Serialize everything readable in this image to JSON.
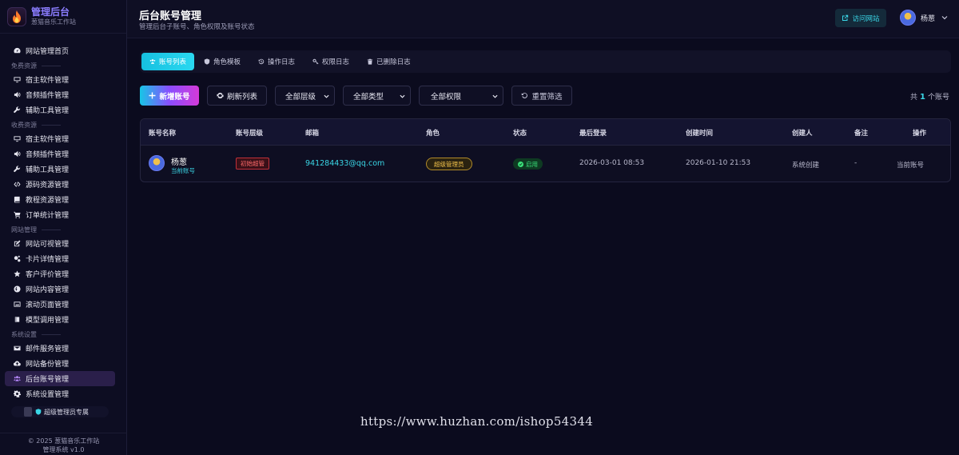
{
  "brand": {
    "title": "管理后台",
    "subtitle": "葱猫音乐工作站"
  },
  "sidebar": {
    "home": "网站管理首页",
    "sections": [
      {
        "title": "免费资源",
        "items": [
          "宿主软件管理",
          "音频插件管理",
          "辅助工具管理"
        ]
      },
      {
        "title": "收费资源",
        "items": [
          "宿主软件管理",
          "音频插件管理",
          "辅助工具管理",
          "源码资源管理",
          "教程资源管理",
          "订单统计管理"
        ]
      },
      {
        "title": "网站管理",
        "items": [
          "网站可视管理",
          "卡片详情管理",
          "客户评价管理",
          "网站内容管理",
          "滚动页面管理",
          "模型调用管理"
        ]
      },
      {
        "title": "系统设置",
        "items": [
          "邮件服务管理",
          "网站备份管理",
          "后台账号管理",
          "系统设置管理"
        ]
      }
    ],
    "vip_label": "超级管理员专属",
    "footer_line1": "© 2025 葱猫音乐工作站",
    "footer_line2": "管理系统 v1.0"
  },
  "header": {
    "title": "后台账号管理",
    "subtitle": "管理后台子账号、角色权限及账号状态",
    "visit_label": "访问网站",
    "user_name": "杨葱"
  },
  "tabs": [
    "账号列表",
    "角色模板",
    "操作日志",
    "权限日志",
    "已删除日志"
  ],
  "toolbar": {
    "add_label": "新增账号",
    "refresh_label": "刷新列表",
    "level_select": "全部层级",
    "type_select": "全部类型",
    "perm_select": "全部权限",
    "reset_label": "重置筛选",
    "count_prefix": "共",
    "count_value": "1",
    "count_suffix": "个账号"
  },
  "table": {
    "columns": [
      "账号名称",
      "账号层级",
      "邮箱",
      "角色",
      "状态",
      "最后登录",
      "创建时间",
      "创建人",
      "备注",
      "操作"
    ],
    "rows": [
      {
        "name": "杨葱",
        "current": "当前账号",
        "level": "初始超管",
        "email": "941284433@qq.com",
        "role": "超级管理员",
        "status": "启用",
        "last_login": "2026-03-01 08:53",
        "created": "2026-01-10 21:53",
        "creator": "系统创建",
        "note": "-",
        "action": "当前账号"
      }
    ]
  },
  "watermark": "https://www.huzhan.com/ishop54344",
  "colors": {
    "accent": "#3ad6e6",
    "active_nav": "#2a1f4a",
    "danger": "#ff6a6a",
    "gold": "#f0c04a",
    "success": "#3ae07a"
  }
}
